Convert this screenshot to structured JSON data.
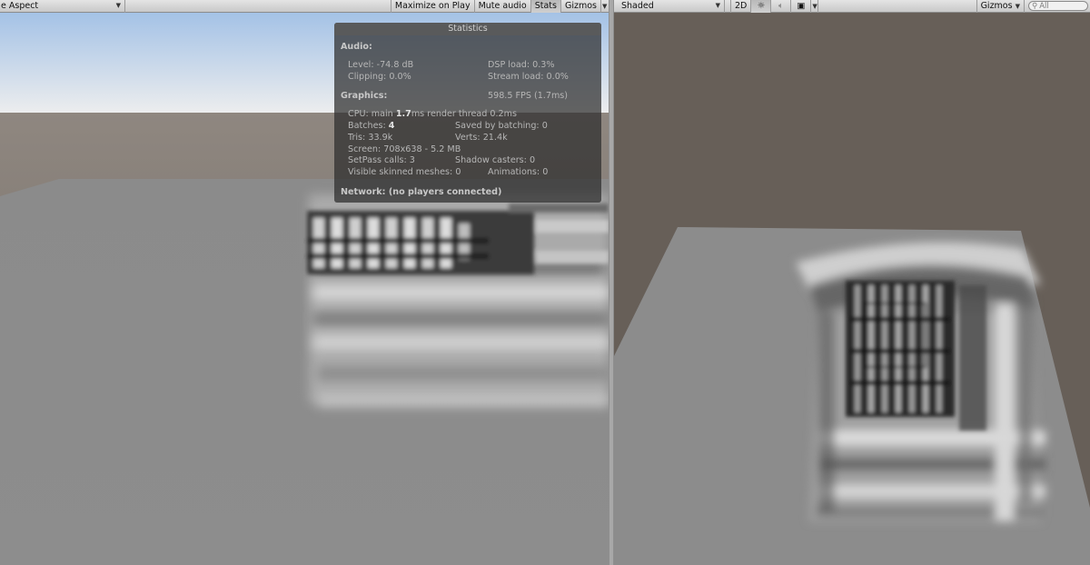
{
  "game_toolbar": {
    "aspect_label": "e Aspect",
    "maximize_label": "Maximize on Play",
    "mute_label": "Mute audio",
    "stats_label": "Stats",
    "gizmos_label": "Gizmos"
  },
  "stats": {
    "title": "Statistics",
    "audio_header": "Audio:",
    "level": "Level: -74.8 dB",
    "dsp_load": "DSP load: 0.3%",
    "clipping": "Clipping: 0.0%",
    "stream_load": "Stream load: 0.0%",
    "graphics_header": "Graphics:",
    "fps": "598.5 FPS (1.7ms)",
    "cpu_prefix": "CPU: main ",
    "cpu_main": "1.7",
    "cpu_suffix": "ms  render thread 0.2ms",
    "batches_prefix": "Batches: ",
    "batches": "4",
    "saved_by_batching": "Saved by batching: 0",
    "tris": "Tris: 33.9k",
    "verts": "Verts: 21.4k",
    "screen": "Screen: 708x638 - 5.2 MB",
    "setpass": "SetPass calls: 3",
    "shadow_casters": "Shadow casters: 0",
    "skinned_meshes": "Visible skinned meshes: 0",
    "animations": "Animations: 0",
    "network": "Network: (no players connected)"
  },
  "scene_toolbar": {
    "shading_mode": "Shaded",
    "mode_2d": "2D",
    "gizmos_label": "Gizmos",
    "search_placeholder": "All"
  },
  "icons": {
    "dropdown": "dropdown-arrow-icon",
    "lighting": "sun-icon",
    "audio": "speaker-icon",
    "effects": "image-icon",
    "search": "search-icon"
  },
  "colors": {
    "sky_top": "#a7c4e6",
    "sky_horizon": "#e9ecef",
    "ground": "#6e6862",
    "plane": "#8f8f8f",
    "scene_bg": "#675f58",
    "stats_bg": "#2d2d2d"
  }
}
